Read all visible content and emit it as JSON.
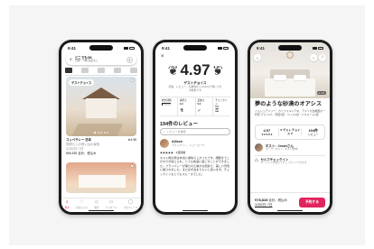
{
  "phone1": {
    "time": "9:41",
    "search": {
      "title": "どこでもOK",
      "subtitle": "日程・人数 指定なし"
    },
    "filter_icon": "sliders-icon",
    "listing": {
      "badge": "ゲストチョイス",
      "title": "コッペラレー 日本",
      "rating": "★4.98",
      "subtitle": "見晴らしの良い山の景色",
      "dates": "11月2日~7日",
      "price": "¥56,535 合計，税込み"
    },
    "tabs": [
      {
        "icon": "search-icon",
        "label": "探す"
      },
      {
        "icon": "heart-icon",
        "label": "お気に入り"
      },
      {
        "icon": "trips-icon",
        "label": "旅行"
      },
      {
        "icon": "messages-icon",
        "label": "メッセージ"
      },
      {
        "icon": "profile-icon",
        "label": "プロフィール"
      }
    ]
  },
  "phone2": {
    "time": "9:41",
    "rating": "4.97",
    "guest_favorite": "ゲストチョイス",
    "guest_favorite_desc": "評価、レビュー、信頼性から Airbnbで特に人気の物件です",
    "categories": [
      {
        "label": "総合評価",
        "score": "",
        "fill": 0.95,
        "icon": ""
      },
      {
        "label": "清潔さ",
        "score": "4.9",
        "fill": 0.9,
        "icon": "spray-icon"
      },
      {
        "label": "正確さ",
        "score": "5.0",
        "fill": 1.0,
        "icon": "check-icon"
      },
      {
        "label": "チェックイン",
        "score": "5.0",
        "fill": 1.0,
        "icon": "key-icon"
      }
    ],
    "reviews_title": "194件のレビュー",
    "review_search_placeholder": "レビューを検索",
    "review": {
      "name": "Allison",
      "meta": "ブルックリン，ニューヨーク",
      "stars": "★★★★★ · 2週間前",
      "body": "ホスト様の家は本当に素晴らしかったです。細部までこだわりが感じられ、とても快適に過ごすことができました。プライバシーが保たれた静かな環境で、美しい景色に癒されました。また必ず泊まりたいと思います。チェックインもとてもスムーズでした。"
    }
  },
  "phone3": {
    "time": "9:41",
    "image_count": "1 / 24",
    "title": "夢のような砂漠のオアシス",
    "subtitle": "ジョシュアツリー，カリフォルニア州，アメリカ合衆国の一軒家 ゲスト4人・寝室2室・ベッド2台・バスルーム1室",
    "stats": [
      {
        "value": "4.97",
        "label": "★★★★★"
      },
      {
        "value": "ゲスト チョイス",
        "label": ""
      },
      {
        "value": "194件",
        "label": "レビュー"
      }
    ],
    "host": {
      "name": "ホスト：Jessieさん",
      "meta": "スーパーホスト · ホスト歴8年"
    },
    "feature": {
      "title": "セルフチェックイン",
      "desc": "キーパッドを使ってチェックインできます"
    },
    "price": {
      "amount": "¥78,828",
      "unit": "合計，税込み",
      "dates": "11月2日~7日"
    },
    "reserve_label": "予約する",
    "accent": "#e0245e"
  }
}
